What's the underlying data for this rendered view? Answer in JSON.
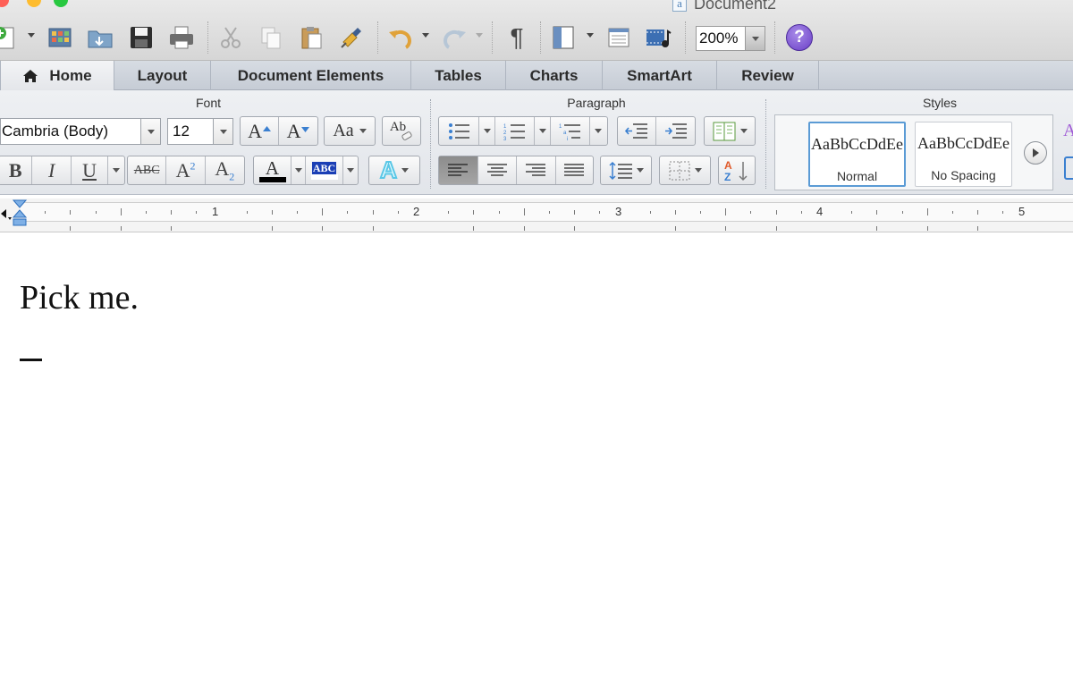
{
  "window": {
    "title": "Document2",
    "doc_icon_glyph": "a"
  },
  "toolbar": {
    "zoom_value": "200%",
    "help_glyph": "?",
    "pilcrow_glyph": "¶",
    "icons": [
      "new-document-icon",
      "templates-icon",
      "open-icon",
      "save-icon",
      "print-icon",
      "cut-icon",
      "copy-icon",
      "paste-icon",
      "format-painter-icon",
      "undo-icon",
      "redo-icon",
      "show-formatting-icon",
      "sidebar-icon",
      "toolbox-icon",
      "media-browser-icon",
      "help-icon"
    ]
  },
  "tabs": [
    {
      "label": "Home",
      "active": true
    },
    {
      "label": "Layout",
      "active": false
    },
    {
      "label": "Document Elements",
      "active": false
    },
    {
      "label": "Tables",
      "active": false
    },
    {
      "label": "Charts",
      "active": false
    },
    {
      "label": "SmartArt",
      "active": false
    },
    {
      "label": "Review",
      "active": false
    }
  ],
  "ribbon": {
    "groups": {
      "font": "Font",
      "paragraph": "Paragraph",
      "styles": "Styles"
    },
    "font": {
      "name": "Cambria (Body)",
      "size": "12",
      "bold_glyph": "B",
      "italic_glyph": "I",
      "underline_glyph": "U",
      "strike_glyph": "ABC",
      "superscript_base": "A",
      "superscript_mark": "2",
      "subscript_base": "A",
      "subscript_mark": "2",
      "grow_glyph": "A",
      "shrink_glyph": "A",
      "case_glyph": "Aa",
      "clear_glyph": "Ab",
      "font_color_glyph": "A",
      "highlight_glyph": "ABC",
      "text_effects_glyph": "A",
      "font_color": "#000000",
      "text_effect_color": "#59c7e6",
      "highlight_color": "#1b3fb5"
    },
    "paragraph": {
      "sort_glyph": "AZ",
      "alignment_active": "left"
    },
    "styles": [
      {
        "sample": "AaBbCcDdEe",
        "name": "Normal",
        "selected": true
      },
      {
        "sample": "AaBbCcDdEe",
        "name": "No Spacing",
        "selected": false
      }
    ]
  },
  "ruler": {
    "numbers": [
      "1",
      "2",
      "3",
      "4",
      "5"
    ]
  },
  "document": {
    "text": "Pick me."
  },
  "colors": {
    "close": "#fe5f57",
    "minimize": "#febc2e",
    "zoom": "#28c840",
    "help_purple": "#7a4fd1",
    "selection_blue": "#5b9bd5"
  }
}
